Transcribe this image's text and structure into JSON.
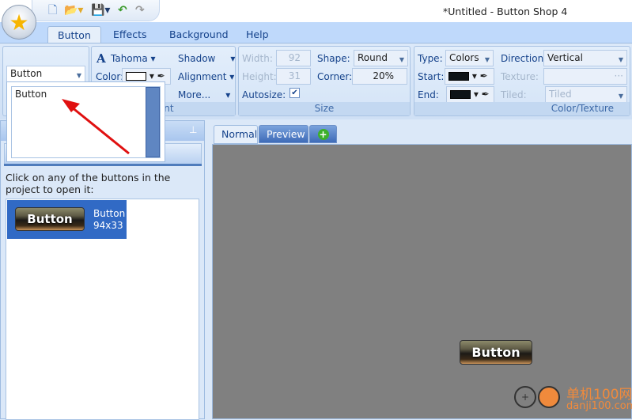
{
  "window": {
    "title": "*Untitled - Button Shop 4"
  },
  "quick_access": {
    "icons": [
      "new-icon",
      "open-icon",
      "save-icon",
      "undo-icon",
      "redo-icon"
    ]
  },
  "ribbon": {
    "tabs": [
      {
        "label": "Button",
        "active": true
      },
      {
        "label": "Effects"
      },
      {
        "label": "Background"
      },
      {
        "label": "Help"
      }
    ],
    "button_select": {
      "value": "Button",
      "options": [
        "Button"
      ]
    },
    "font": {
      "name": "Tahoma",
      "color_label": "Color:",
      "color": "#ffffff",
      "shadow": "Shadow",
      "alignment": "Alignment",
      "more": "More...",
      "group_label": "Font"
    },
    "size": {
      "width_label": "Width:",
      "width": "92",
      "height_label": "Height:",
      "height": "31",
      "autosize_label": "Autosize:",
      "autosize": true,
      "shape_label": "Shape:",
      "shape": "Round",
      "corner_label": "Corner:",
      "corner": "20%",
      "group_label": "Size"
    },
    "color_texture": {
      "type_label": "Type:",
      "type": "Colors",
      "direction_label": "Direction:",
      "direction": "Vertical",
      "start_label": "Start:",
      "start_color": "#0d1317",
      "end_label": "End:",
      "end_color": "#0d1317",
      "texture_label": "Texture:",
      "texture_browse": "···",
      "tiled_label": "Tiled:",
      "tiled": "Tiled",
      "group_label": "Color/Texture"
    }
  },
  "left_panel": {
    "instructions": "Click on any of the buttons in the project to open it:",
    "items": [
      {
        "preview_text": "Button",
        "name": "Button",
        "size": "94x33"
      }
    ]
  },
  "view_tabs": [
    {
      "label": "Normal",
      "active": true
    },
    {
      "label": "Preview"
    },
    {
      "label": "+"
    }
  ],
  "canvas": {
    "button_text": "Button",
    "background": "#808080"
  },
  "watermark": {
    "cn": "单机100网",
    "url": "danji100.com"
  }
}
